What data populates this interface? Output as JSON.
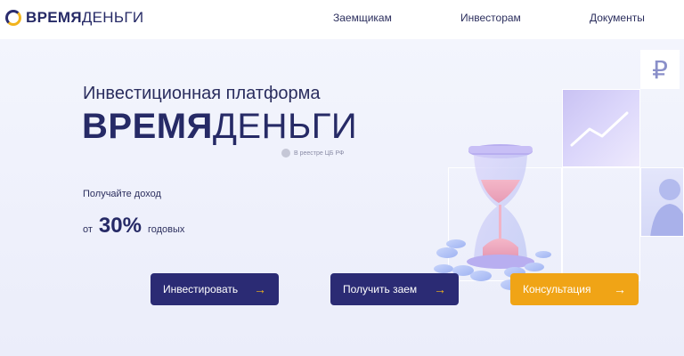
{
  "header": {
    "logo_bold": "ВРЕМЯ",
    "logo_light": "ДЕНЬГИ",
    "nav": [
      "Заемщикам",
      "Инвесторам",
      "Документы"
    ]
  },
  "hero": {
    "subtitle": "Инвестиционная платформа",
    "brand_bold": "ВРЕМЯ",
    "brand_light": "ДЕНЬГИ",
    "registry_note": "В реестре ЦБ РФ",
    "income_label": "Получайте доход",
    "rate_from": "от",
    "rate_value": "30%",
    "rate_suffix": "годовых"
  },
  "tiles": {
    "currency_symbol": "₽"
  },
  "buttons": {
    "invest": "Инвестировать",
    "loan": "Получить заем",
    "consult": "Консультация",
    "arrow": "→"
  },
  "colors": {
    "brand_navy": "#262a66",
    "button_navy": "#2b2b74",
    "accent_yellow": "#f0a416"
  },
  "icons": [
    "logo-ring-icon",
    "ruble-icon",
    "chart-up-icon",
    "person-icon",
    "hourglass-illustration",
    "arrow-right-icon"
  ]
}
